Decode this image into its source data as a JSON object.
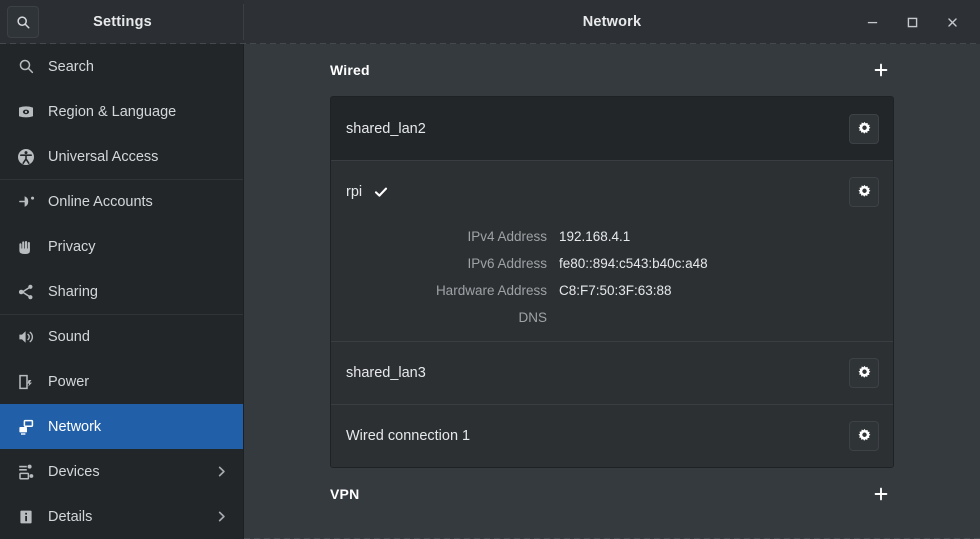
{
  "window": {
    "app_title": "Settings",
    "page_title": "Network",
    "controls": {
      "minimize": "minimize-window",
      "maximize": "maximize-window",
      "close": "close-window"
    },
    "search_button_icon": "search-icon"
  },
  "sidebar": {
    "groups": [
      {
        "items": [
          {
            "label": "Search",
            "icon": "search-icon",
            "selected": false,
            "chevron": false
          },
          {
            "label": "Region & Language",
            "icon": "region-language-icon",
            "selected": false,
            "chevron": false
          },
          {
            "label": "Universal Access",
            "icon": "universal-access-icon",
            "selected": false,
            "chevron": false
          }
        ]
      },
      {
        "items": [
          {
            "label": "Online Accounts",
            "icon": "online-accounts-icon",
            "selected": false,
            "chevron": false
          },
          {
            "label": "Privacy",
            "icon": "privacy-hand-icon",
            "selected": false,
            "chevron": false
          },
          {
            "label": "Sharing",
            "icon": "sharing-icon",
            "selected": false,
            "chevron": false
          }
        ]
      },
      {
        "items": [
          {
            "label": "Sound",
            "icon": "sound-speaker-icon",
            "selected": false,
            "chevron": false
          },
          {
            "label": "Power",
            "icon": "power-battery-icon",
            "selected": false,
            "chevron": false
          },
          {
            "label": "Network",
            "icon": "network-icon",
            "selected": true,
            "chevron": false
          },
          {
            "label": "Devices",
            "icon": "devices-icon",
            "selected": false,
            "chevron": true
          },
          {
            "label": "Details",
            "icon": "details-info-icon",
            "selected": false,
            "chevron": true
          }
        ]
      }
    ]
  },
  "main": {
    "sections": [
      {
        "title": "Wired",
        "add_icon": "plus-icon",
        "connections": [
          {
            "name": "shared_lan2",
            "active": false,
            "shaded": true,
            "settings_icon": "gear-icon",
            "details": []
          },
          {
            "name": "rpi",
            "active": true,
            "shaded": false,
            "check_icon": "check-icon",
            "settings_icon": "gear-icon",
            "details": [
              {
                "label": "IPv4 Address",
                "value": "192.168.4.1"
              },
              {
                "label": "IPv6 Address",
                "value": "fe80::894:c543:b40c:a48"
              },
              {
                "label": "Hardware Address",
                "value": "C8:F7:50:3F:63:88"
              },
              {
                "label": "DNS",
                "value": ""
              }
            ]
          },
          {
            "name": "shared_lan3",
            "active": false,
            "shaded": false,
            "settings_icon": "gear-icon",
            "details": []
          },
          {
            "name": "Wired connection 1",
            "active": false,
            "shaded": false,
            "settings_icon": "gear-icon",
            "details": []
          }
        ]
      },
      {
        "title": "VPN",
        "add_icon": "plus-icon",
        "connections": []
      }
    ]
  },
  "colors": {
    "accent": "#2160a8",
    "window_bg": "#353a3f",
    "sidebar_bg": "#232629",
    "row_bg": "#2d3033",
    "row_bg_shaded": "#232629"
  }
}
